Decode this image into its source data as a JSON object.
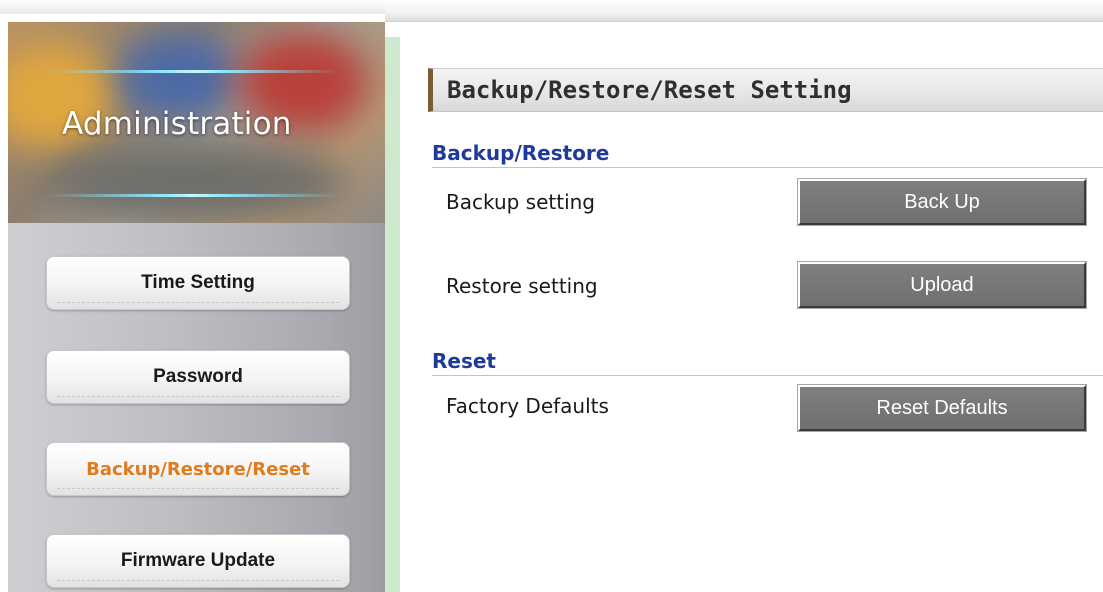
{
  "sidebar": {
    "banner_title": "Administration",
    "items": [
      {
        "label": "Time Setting",
        "active": false
      },
      {
        "label": "Password",
        "active": false
      },
      {
        "label": "Backup/Restore/Reset",
        "active": true
      },
      {
        "label": "Firmware Update",
        "active": false
      }
    ],
    "active_color": "#e07b1e"
  },
  "main": {
    "title": "Backup/Restore/Reset Setting",
    "sections": [
      {
        "title": "Backup/Restore",
        "rows": [
          {
            "label": "Backup setting",
            "button": "Back Up"
          },
          {
            "label": "Restore setting",
            "button": "Upload"
          }
        ]
      },
      {
        "title": "Reset",
        "rows": [
          {
            "label": "Factory Defaults",
            "button": "Reset Defaults"
          }
        ]
      }
    ],
    "section_title_color": "#1f3a9c",
    "button_color": "#777777"
  }
}
